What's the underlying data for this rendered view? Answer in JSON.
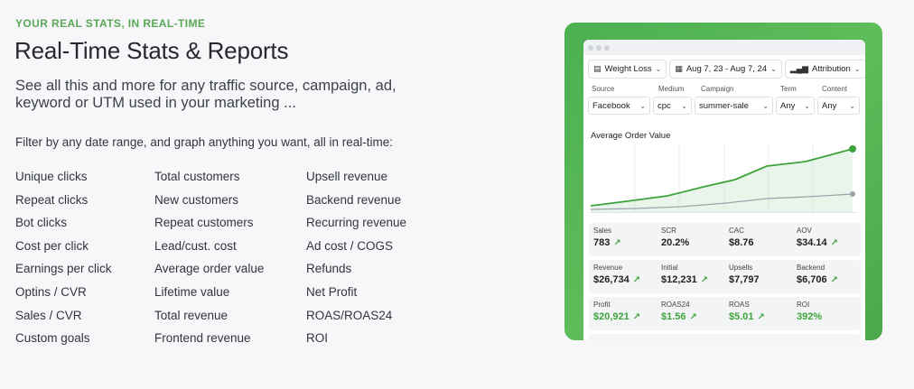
{
  "header": {
    "eyebrow": "YOUR REAL STATS, IN REAL-TIME",
    "title": "Real-Time Stats & Reports",
    "subtitle": "See all this and more for any traffic source, campaign, ad, keyword or UTM used in your marketing ...",
    "filter_text": "Filter by any date range, and graph anything you want, all in real-time:"
  },
  "metrics": {
    "col1": [
      "Unique clicks",
      "Repeat clicks",
      "Bot clicks",
      "Cost per click",
      "Earnings per click",
      "Optins / CVR",
      "Sales / CVR",
      "Custom goals"
    ],
    "col2": [
      "Total customers",
      "New customers",
      "Repeat customers",
      "Lead/cust. cost",
      "Average order value",
      "Lifetime value",
      "Total revenue",
      "Frontend revenue"
    ],
    "col3": [
      "Upsell revenue",
      "Backend revenue",
      "Recurring revenue",
      "Ad cost / COGS",
      "Refunds",
      "Net Profit",
      "ROAS/ROAS24",
      "ROI"
    ]
  },
  "panel": {
    "top_filters": {
      "funnel": "Weight Loss",
      "date_range": "Aug 7, 23 - Aug 7, 24",
      "attribution": "Attribution"
    },
    "field_labels": {
      "source": "Source",
      "medium": "Medium",
      "campaign": "Campaign",
      "term": "Term",
      "content": "Content"
    },
    "field_values": {
      "source": "Facebook",
      "medium": "cpc",
      "campaign": "summer-sale",
      "term": "Any",
      "content": "Any"
    },
    "chart_title": "Average Order Value",
    "stats_row1": [
      {
        "label": "Sales",
        "value": "783",
        "trend": true
      },
      {
        "label": "SCR",
        "value": "20.2%",
        "trend": false
      },
      {
        "label": "CAC",
        "value": "$8.76",
        "trend": false
      },
      {
        "label": "AOV",
        "value": "$34.14",
        "trend": true
      }
    ],
    "stats_row2": [
      {
        "label": "Revenue",
        "value": "$26,734",
        "trend": true
      },
      {
        "label": "Initial",
        "value": "$12,231",
        "trend": true
      },
      {
        "label": "Upsells",
        "value": "$7,797",
        "trend": false
      },
      {
        "label": "Backend",
        "value": "$6,706",
        "trend": true
      }
    ],
    "stats_row3": [
      {
        "label": "Profit",
        "value": "$20,921",
        "trend": true
      },
      {
        "label": "ROAS24",
        "value": "$1.56",
        "trend": true
      },
      {
        "label": "ROAS",
        "value": "$5.01",
        "trend": true
      },
      {
        "label": "ROI",
        "value": "392%",
        "trend": false
      }
    ]
  },
  "colors": {
    "accent": "#5aa857",
    "panel_green": "#4caf50",
    "trend_green": "#3ea33b"
  }
}
